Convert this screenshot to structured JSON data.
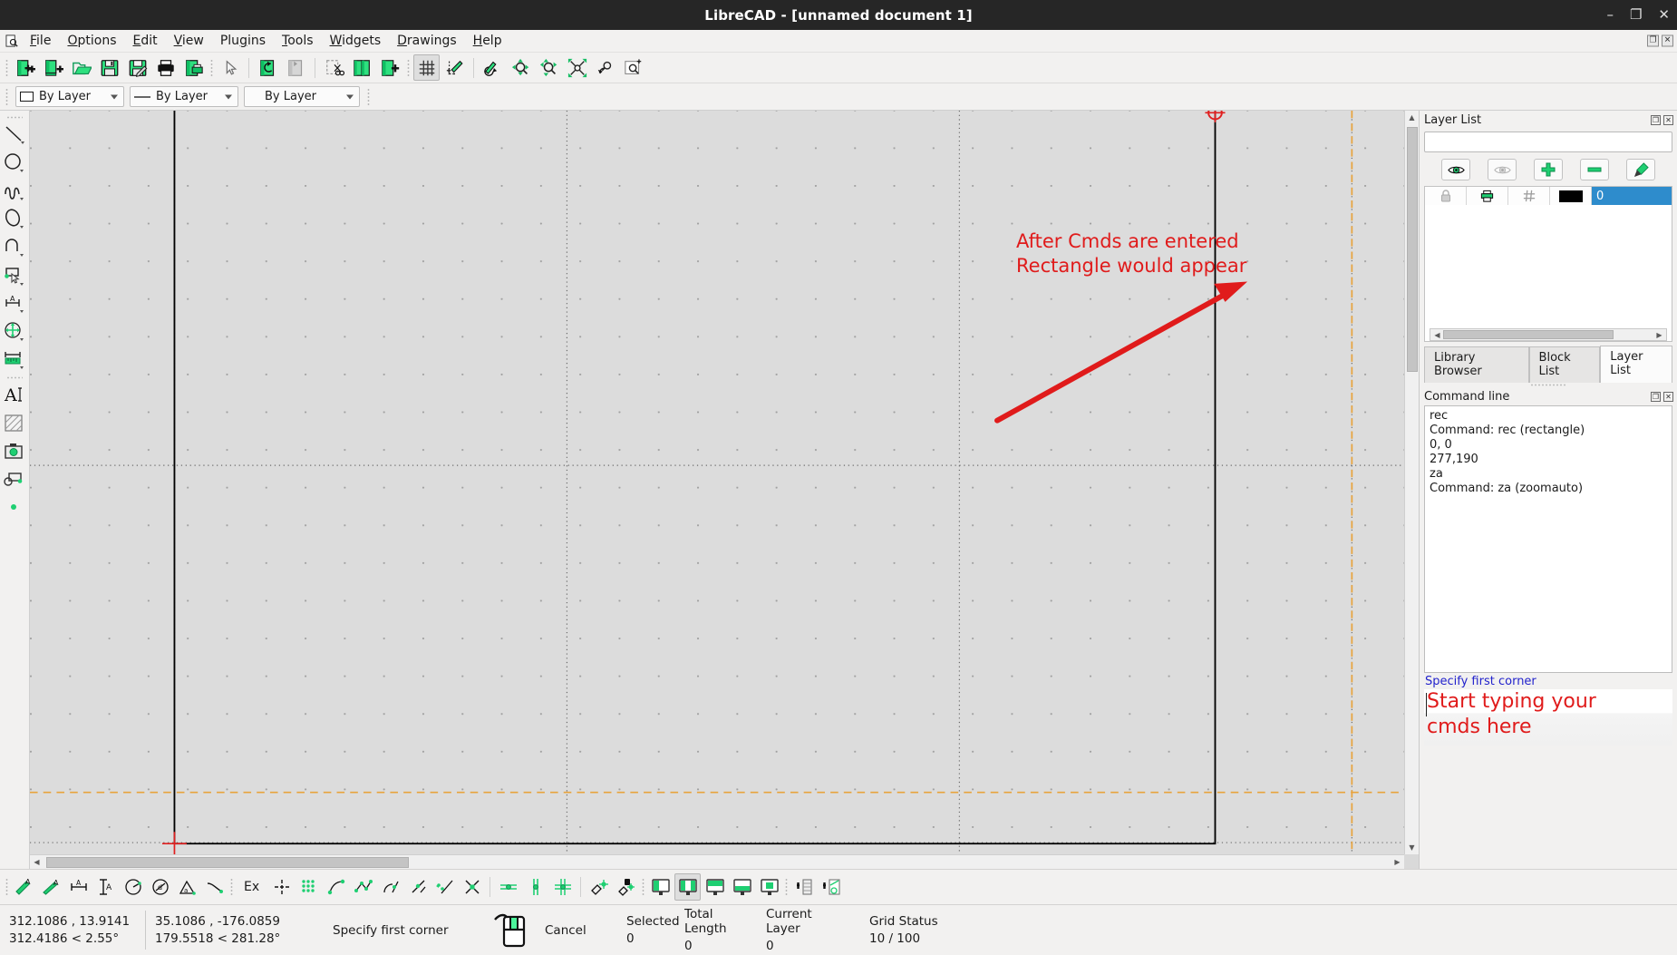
{
  "window": {
    "title": "LibreCAD - [unnamed document 1]",
    "minimize_label": "–",
    "maximize_label": "❐",
    "close_label": "✕"
  },
  "menubar": {
    "app_icon": "document-search-icon",
    "items": [
      {
        "label": "File",
        "mnemonic": "F"
      },
      {
        "label": "Options",
        "mnemonic": "O"
      },
      {
        "label": "Edit",
        "mnemonic": "E"
      },
      {
        "label": "View",
        "mnemonic": "V"
      },
      {
        "label": "Plugins",
        "mnemonic": "g"
      },
      {
        "label": "Tools",
        "mnemonic": "T"
      },
      {
        "label": "Widgets",
        "mnemonic": "W"
      },
      {
        "label": "Drawings",
        "mnemonic": "D"
      },
      {
        "label": "Help",
        "mnemonic": "H"
      }
    ],
    "dock_restore_label": "❐",
    "dock_close_label": "✕"
  },
  "toolbar": {
    "items": [
      {
        "name": "new-file-icon",
        "title": "New"
      },
      {
        "name": "new-from-template-icon",
        "title": "New from template"
      },
      {
        "name": "open-folder-icon",
        "title": "Open"
      },
      {
        "name": "save-icon",
        "title": "Save"
      },
      {
        "name": "save-as-icon",
        "title": "Save As"
      },
      {
        "name": "print-icon",
        "title": "Print"
      },
      {
        "name": "print-preview-icon",
        "title": "Print Preview"
      },
      {
        "name": "cursor-select-icon",
        "title": "Select"
      },
      {
        "name": "undo-icon",
        "title": "Undo"
      },
      {
        "name": "redo-icon",
        "title": "Redo"
      },
      {
        "name": "cut-icon",
        "title": "Cut"
      },
      {
        "name": "copy-icon",
        "title": "Copy"
      },
      {
        "name": "paste-icon",
        "title": "Paste"
      },
      {
        "name": "grid-toggle-icon",
        "title": "Toggle Grid",
        "pressed": true
      },
      {
        "name": "draw-order-icon",
        "title": "Draw Order"
      },
      {
        "name": "redraw-icon",
        "title": "Redraw"
      },
      {
        "name": "zoom-pan-icon",
        "title": "Zoom Pan"
      },
      {
        "name": "zoom-window-icon",
        "title": "Zoom Window"
      },
      {
        "name": "zoom-auto-icon",
        "title": "Zoom Auto"
      },
      {
        "name": "zoom-previous-icon",
        "title": "Zoom Previous"
      },
      {
        "name": "zoom-in-icon",
        "title": "Zoom In"
      }
    ]
  },
  "attribute_combos": [
    {
      "name": "layer-color-combo",
      "value": "By Layer",
      "kind": "color"
    },
    {
      "name": "line-width-combo",
      "value": "By Layer",
      "kind": "width"
    },
    {
      "name": "line-type-combo",
      "value": "By Layer",
      "kind": "type"
    }
  ],
  "left_toolbar": {
    "items": [
      {
        "name": "line-tool-icon",
        "title": "Line"
      },
      {
        "name": "circle-tool-icon",
        "title": "Circle"
      },
      {
        "name": "spline-tool-icon",
        "title": "Spline"
      },
      {
        "name": "ellipse-tool-icon",
        "title": "Ellipse"
      },
      {
        "name": "arc-tool-icon",
        "title": "Arc"
      },
      {
        "name": "polyline-select-tool-icon",
        "title": "Polyline"
      },
      {
        "name": "dimension-linear-tool-icon",
        "title": "Dimension"
      },
      {
        "name": "modify-move-rotate-tool-icon",
        "title": "Modify"
      },
      {
        "name": "measure-tool-icon",
        "title": "Info / Measure"
      },
      {
        "name": "text-tool-icon",
        "title": "Text"
      },
      {
        "name": "hatch-tool-icon",
        "title": "Hatch"
      },
      {
        "name": "image-tool-icon",
        "title": "Insert Image"
      },
      {
        "name": "block-tool-icon",
        "title": "Block"
      },
      {
        "name": "point-tool-icon",
        "title": "Point"
      }
    ]
  },
  "canvas": {
    "annotation_line1": "After Cmds are entered",
    "annotation_line2": "Rectangle would appear",
    "annotation_color": "#e01b1b",
    "origin_marker": "origin-crosshair-marker",
    "background_color": "#dcdcdc",
    "grid_point_color": "#a8a8a8",
    "paper_border_color": "#000000",
    "margin_guide_color": "#e8a33d"
  },
  "layer_panel": {
    "title": "Layer List",
    "search_placeholder": "",
    "search_value": "",
    "buttons": [
      {
        "name": "show-all-layers-button",
        "icon": "eye-open-icon"
      },
      {
        "name": "hide-all-layers-button",
        "icon": "eye-closed-icon"
      },
      {
        "name": "add-layer-button",
        "icon": "plus-icon"
      },
      {
        "name": "remove-layer-button",
        "icon": "minus-icon"
      },
      {
        "name": "edit-layer-button",
        "icon": "pencil-edit-icon"
      }
    ],
    "columns": [
      "lock-icon",
      "print-icon",
      "construction-icon",
      "color-swatch",
      "name"
    ],
    "rows": [
      {
        "lock": "lock-closed-icon",
        "print": "printer-icon",
        "construction": "grid-hash-icon",
        "color": "#000000",
        "name": "0",
        "selected": true
      }
    ],
    "restore_label": "❐",
    "close_label": "✕"
  },
  "dock_tabs": [
    {
      "label": "Library Browser",
      "active": false
    },
    {
      "label": "Block List",
      "active": false
    },
    {
      "label": "Layer List",
      "active": true
    }
  ],
  "command_panel": {
    "title": "Command line",
    "restore_label": "❐",
    "close_label": "✕",
    "history": [
      "rec",
      "Command: rec (rectangle)",
      "0, 0",
      "277,190",
      "za",
      "Command: za (zoomauto)"
    ],
    "prompt": "Specify first corner",
    "prompt_color": "#2222cc",
    "input_annotation_line1": "Start typing your",
    "input_annotation_line2": "cmds here",
    "input_annotation_color": "#e01b1b"
  },
  "bottom_toolbar": {
    "items": [
      {
        "name": "snap-free-icon"
      },
      {
        "name": "snap-grid-align-icon"
      },
      {
        "name": "dimension-horizontal-icon"
      },
      {
        "name": "dimension-vertical-icon"
      },
      {
        "name": "dimension-angular-icon"
      },
      {
        "name": "dimension-diameter-icon"
      },
      {
        "name": "dimension-angle-icon"
      },
      {
        "name": "dimension-leader-icon"
      },
      {
        "name": "snap-extend-label",
        "label": "Ex"
      },
      {
        "name": "snap-free-crosshair-icon"
      },
      {
        "name": "snap-grid-icon"
      },
      {
        "name": "snap-endpoint-icon"
      },
      {
        "name": "snap-on-entity-icon"
      },
      {
        "name": "snap-center-icon"
      },
      {
        "name": "snap-middle-icon"
      },
      {
        "name": "snap-distance-icon"
      },
      {
        "name": "snap-intersection-icon"
      },
      {
        "name": "restrict-horizontal-icon"
      },
      {
        "name": "restrict-vertical-icon"
      },
      {
        "name": "restrict-orthogonal-icon"
      },
      {
        "name": "relative-zero-icon"
      },
      {
        "name": "lock-relative-zero-icon"
      },
      {
        "name": "fullscreen-left-icon"
      },
      {
        "name": "fullscreen-center-icon",
        "pressed": true
      },
      {
        "name": "fullscreen-right-icon"
      },
      {
        "name": "fullscreen-bottom-icon"
      },
      {
        "name": "fullscreen-small-icon"
      },
      {
        "name": "add-layer-panel-icon"
      },
      {
        "name": "add-block-panel-icon"
      }
    ]
  },
  "statusbar": {
    "absolute_coord": "312.1086 , 13.9141",
    "absolute_polar": "312.4186 < 2.55°",
    "relative_coord": "35.1086 , -176.0859",
    "relative_polar": "179.5518 < 281.28°",
    "action_label": "Specify first corner",
    "mouse_icon": "mouse-left-button-icon",
    "cancel_label": "Cancel",
    "fields": [
      {
        "key": "Selected",
        "value": "0"
      },
      {
        "key": "Total Length",
        "value": "0"
      },
      {
        "key": "Current Layer",
        "value": "0"
      },
      {
        "key": "Grid Status",
        "value": "10 / 100"
      }
    ]
  }
}
